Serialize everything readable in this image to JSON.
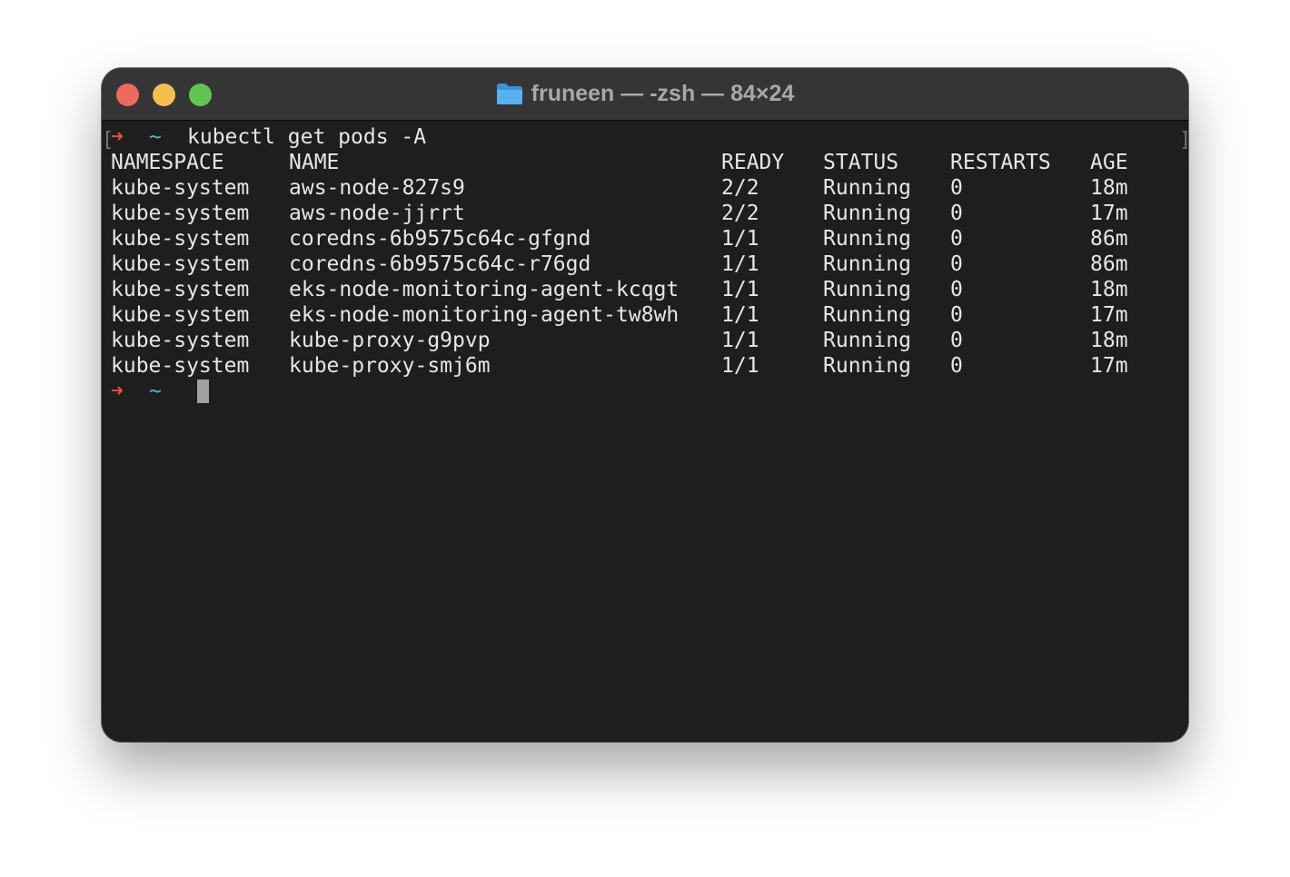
{
  "window": {
    "title": "fruneen — -zsh — 84×24",
    "folder_icon": "folder-icon"
  },
  "terminal": {
    "prompt_arrow": "➜",
    "prompt_dir": "~",
    "command": "kubectl get pods -A",
    "open_bracket": "[",
    "close_bracket": "]",
    "headers": {
      "namespace": "NAMESPACE",
      "name": "NAME",
      "ready": "READY",
      "status": "STATUS",
      "restarts": "RESTARTS",
      "age": "AGE"
    },
    "rows": [
      {
        "namespace": "kube-system",
        "name": "aws-node-827s9",
        "ready": "2/2",
        "status": "Running",
        "restarts": "0",
        "age": "18m"
      },
      {
        "namespace": "kube-system",
        "name": "aws-node-jjrrt",
        "ready": "2/2",
        "status": "Running",
        "restarts": "0",
        "age": "17m"
      },
      {
        "namespace": "kube-system",
        "name": "coredns-6b9575c64c-gfgnd",
        "ready": "1/1",
        "status": "Running",
        "restarts": "0",
        "age": "86m"
      },
      {
        "namespace": "kube-system",
        "name": "coredns-6b9575c64c-r76gd",
        "ready": "1/1",
        "status": "Running",
        "restarts": "0",
        "age": "86m"
      },
      {
        "namespace": "kube-system",
        "name": "eks-node-monitoring-agent-kcqgt",
        "ready": "1/1",
        "status": "Running",
        "restarts": "0",
        "age": "18m"
      },
      {
        "namespace": "kube-system",
        "name": "eks-node-monitoring-agent-tw8wh",
        "ready": "1/1",
        "status": "Running",
        "restarts": "0",
        "age": "17m"
      },
      {
        "namespace": "kube-system",
        "name": "kube-proxy-g9pvp",
        "ready": "1/1",
        "status": "Running",
        "restarts": "0",
        "age": "18m"
      },
      {
        "namespace": "kube-system",
        "name": "kube-proxy-smj6m",
        "ready": "1/1",
        "status": "Running",
        "restarts": "0",
        "age": "17m"
      }
    ],
    "colors": {
      "arrow": "#e0543d",
      "tilde": "#4fb9c9",
      "background": "#1e1e1e",
      "text": "#e6e6e6"
    }
  }
}
